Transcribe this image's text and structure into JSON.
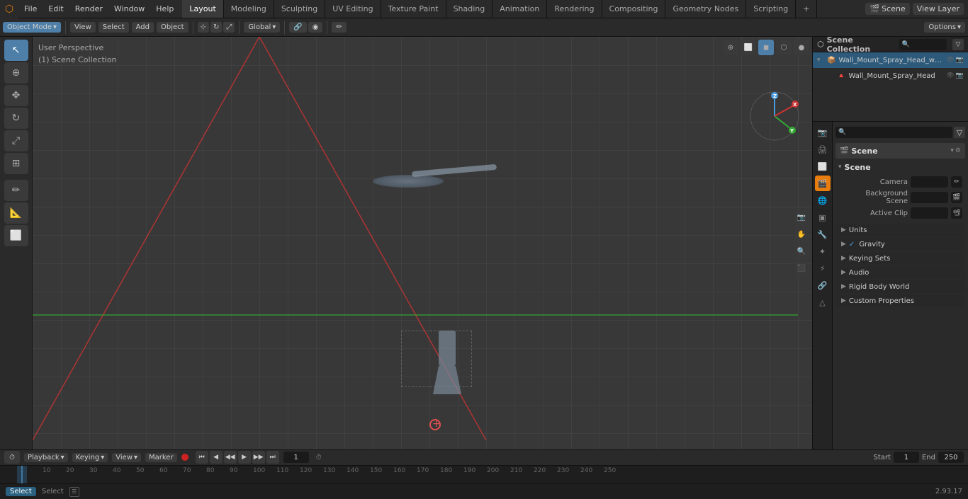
{
  "app": {
    "title": "Blender",
    "version": "2.93.17"
  },
  "menu": {
    "items": [
      "File",
      "Edit",
      "Render",
      "Window",
      "Help"
    ]
  },
  "workspace_tabs": [
    {
      "label": "Layout",
      "active": true
    },
    {
      "label": "Modeling"
    },
    {
      "label": "Sculpting"
    },
    {
      "label": "UV Editing"
    },
    {
      "label": "Texture Paint"
    },
    {
      "label": "Shading"
    },
    {
      "label": "Animation"
    },
    {
      "label": "Rendering"
    },
    {
      "label": "Compositing"
    },
    {
      "label": "Geometry Nodes"
    },
    {
      "label": "Scripting"
    }
  ],
  "top_right": {
    "scene_label": "Scene",
    "view_layer_label": "View Layer"
  },
  "viewport": {
    "mode": "Object Mode",
    "view_menu": "View",
    "select_menu": "Select",
    "add_menu": "Add",
    "object_menu": "Object",
    "view_label": "User Perspective",
    "collection_label": "(1) Scene Collection",
    "transform": "Global",
    "options_label": "Options"
  },
  "outliner": {
    "title": "Scene Collection",
    "items": [
      {
        "label": "Wall_Mount_Spray_Head_with_",
        "icon": "📦",
        "expanded": true,
        "indent": 0,
        "children": [
          {
            "label": "Wall_Mount_Spray_Head",
            "icon": "🔺",
            "indent": 1
          }
        ]
      }
    ]
  },
  "properties": {
    "scene_title": "Scene",
    "scene_icon": "🎬",
    "sections": [
      {
        "title": "Scene",
        "expanded": true,
        "rows": [
          {
            "label": "Camera",
            "value": "",
            "has_icon": true
          },
          {
            "label": "Background Scene",
            "value": "",
            "has_icon": true
          },
          {
            "label": "Active Clip",
            "value": "",
            "has_icon": true
          }
        ]
      },
      {
        "title": "Units",
        "expanded": false
      },
      {
        "title": "Gravity",
        "expanded": false,
        "checked": true
      },
      {
        "title": "Keying Sets",
        "expanded": false
      },
      {
        "title": "Audio",
        "expanded": false
      },
      {
        "title": "Rigid Body World",
        "expanded": false
      },
      {
        "title": "Custom Properties",
        "expanded": false
      }
    ]
  },
  "timeline": {
    "playback_label": "Playback",
    "keying_label": "Keying",
    "view_label": "View",
    "marker_label": "Marker",
    "current_frame": "1",
    "start_label": "Start",
    "start_frame": "1",
    "end_label": "End",
    "end_frame": "250",
    "ticks": [
      {
        "value": "1",
        "pos": 28
      },
      {
        "value": "10",
        "pos": 55
      },
      {
        "value": "20",
        "pos": 88
      },
      {
        "value": "30",
        "pos": 121
      },
      {
        "value": "40",
        "pos": 154
      },
      {
        "value": "50",
        "pos": 187
      },
      {
        "value": "60",
        "pos": 220
      },
      {
        "value": "70",
        "pos": 253
      },
      {
        "value": "80",
        "pos": 286
      },
      {
        "value": "90",
        "pos": 319
      },
      {
        "value": "100",
        "pos": 352
      },
      {
        "value": "110",
        "pos": 385
      },
      {
        "value": "120",
        "pos": 418
      },
      {
        "value": "130",
        "pos": 451
      },
      {
        "value": "140",
        "pos": 484
      },
      {
        "value": "150",
        "pos": 517
      },
      {
        "value": "160",
        "pos": 550
      },
      {
        "value": "170",
        "pos": 583
      },
      {
        "value": "180",
        "pos": 616
      },
      {
        "value": "190",
        "pos": 649
      },
      {
        "value": "200",
        "pos": 682
      },
      {
        "value": "210",
        "pos": 715
      },
      {
        "value": "220",
        "pos": 748
      },
      {
        "value": "230",
        "pos": 781
      },
      {
        "value": "240",
        "pos": 814
      },
      {
        "value": "250",
        "pos": 847
      }
    ]
  },
  "status": {
    "select_label": "Select",
    "version": "2.93.17"
  },
  "prop_icons": [
    {
      "id": "render",
      "symbol": "📷",
      "tooltip": "Render Properties"
    },
    {
      "id": "output",
      "symbol": "🖨",
      "tooltip": "Output Properties"
    },
    {
      "id": "view-layer",
      "symbol": "⬜",
      "tooltip": "View Layer"
    },
    {
      "id": "scene",
      "symbol": "🎬",
      "tooltip": "Scene Properties",
      "active": true
    },
    {
      "id": "world",
      "symbol": "🌐",
      "tooltip": "World Properties"
    },
    {
      "id": "object",
      "symbol": "▣",
      "tooltip": "Object Properties"
    },
    {
      "id": "modifier",
      "symbol": "🔧",
      "tooltip": "Modifier Properties"
    },
    {
      "id": "particles",
      "symbol": "✦",
      "tooltip": "Particle Properties"
    },
    {
      "id": "physics",
      "symbol": "⚡",
      "tooltip": "Physics Properties"
    },
    {
      "id": "constraints",
      "symbol": "🔗",
      "tooltip": "Constraint Properties"
    },
    {
      "id": "data",
      "symbol": "△",
      "tooltip": "Data Properties"
    }
  ]
}
